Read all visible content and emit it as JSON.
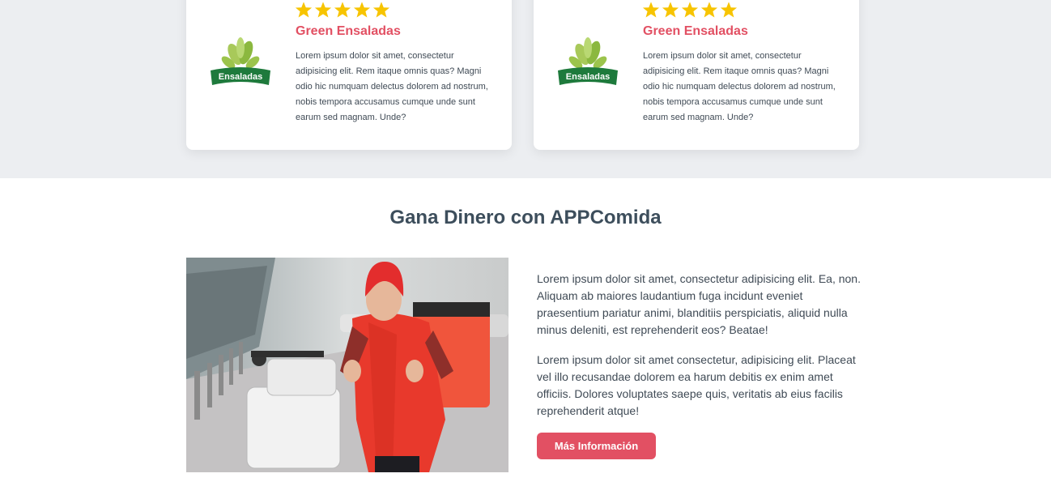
{
  "reviews": [
    {
      "rating": 5,
      "logo_text": "Ensaladas",
      "name": "Green Ensaladas",
      "text": "Lorem ipsum dolor sit amet, consectetur adipisicing elit. Rem itaque omnis quas? Magni odio hic numquam delectus dolorem ad nostrum, nobis tempora accusamus cumque unde sunt earum sed magnam. Unde?"
    },
    {
      "rating": 5,
      "logo_text": "Ensaladas",
      "name": "Green Ensaladas",
      "text": "Lorem ipsum dolor sit amet, consectetur adipisicing elit. Rem itaque omnis quas? Magni odio hic numquam delectus dolorem ad nostrum, nobis tempora accusamus cumque unde sunt earum sed magnam. Unde?"
    }
  ],
  "earn": {
    "title": "Gana Dinero con APPComida",
    "paragraph1": "Lorem ipsum dolor sit amet, consectetur adipisicing elit. Ea, non. Aliquam ab maiores laudantium fuga incidunt eveniet praesentium pariatur animi, blanditiis perspiciatis, aliquid nulla minus deleniti, est reprehenderit eos? Beatae!",
    "paragraph2": "Lorem ipsum dolor sit amet consectetur, adipisicing elit. Placeat vel illo recusandae dolorem ea harum debitis ex enim amet officiis. Dolores voluptates saepe quis, veritatis ab eius facilis reprehenderit atque!",
    "button_label": "Más Información"
  },
  "colors": {
    "accent": "#e25063",
    "star": "#f7c400",
    "heading": "#3d4e5c",
    "band": "#eceef1"
  }
}
